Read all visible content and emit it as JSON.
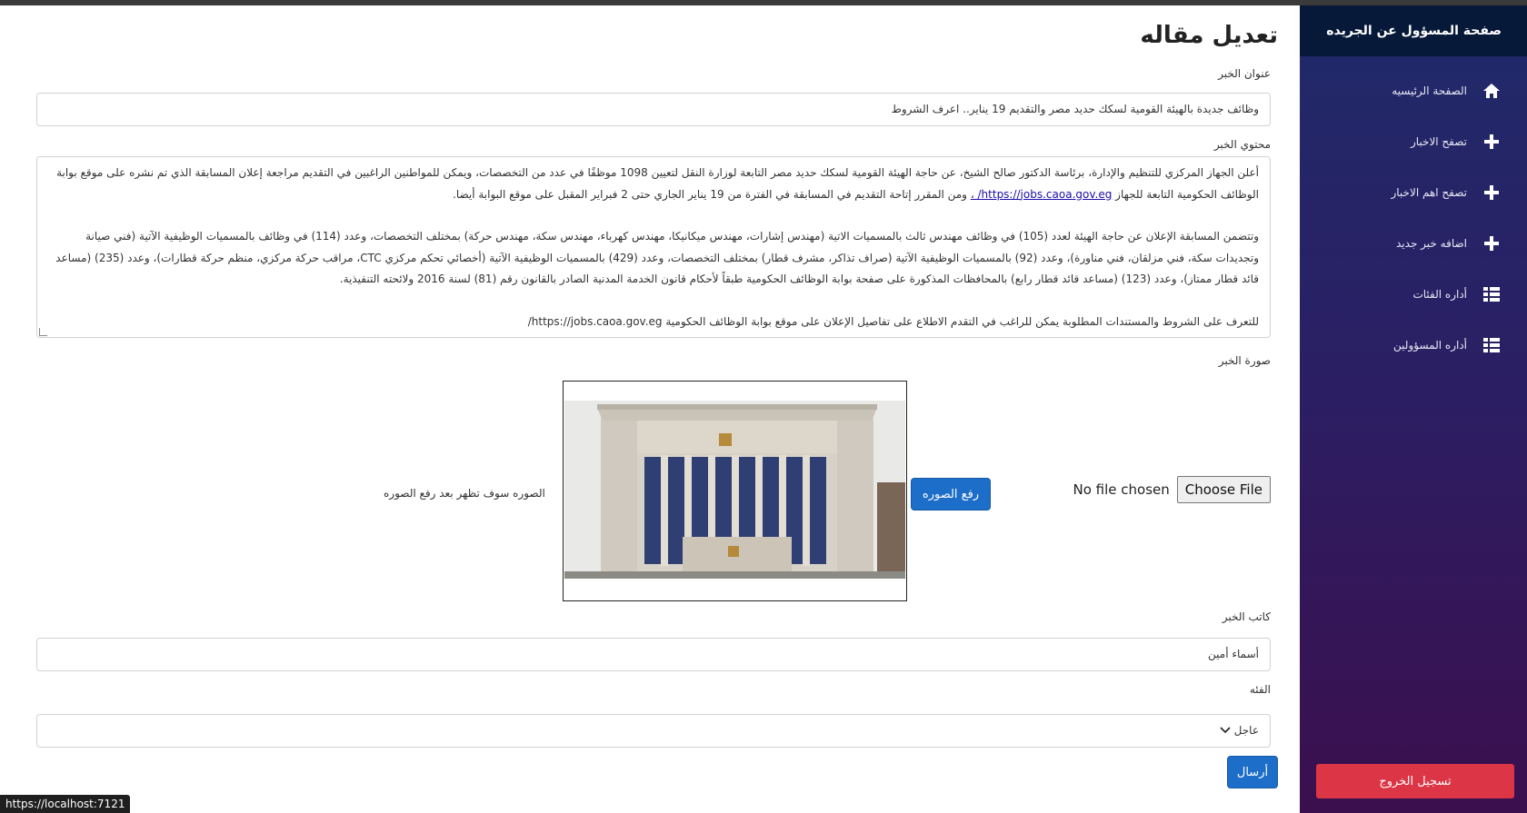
{
  "sidebar": {
    "title": "صفحة المسؤول عن الجريده",
    "items": [
      {
        "label": "الصفحة الرئيسيه",
        "icon": "home-icon"
      },
      {
        "label": "تصفح الاخبار",
        "icon": "plus-icon"
      },
      {
        "label": "تصفح اهم الاخبار",
        "icon": "plus-icon"
      },
      {
        "label": "اضافه خبر جديد",
        "icon": "plus-icon"
      },
      {
        "label": "أداره الفئات",
        "icon": "list-icon"
      },
      {
        "label": "أداره المسؤولين",
        "icon": "list-icon"
      }
    ],
    "logout_label": "تسجيل الخروج"
  },
  "form": {
    "page_title": "تعديل مقاله",
    "title_label": "عنوان الخبر",
    "title_value": "وظائف جديدة بالهيئة القومية لسكك حديد مصر والتقديم 19 يناير.. اعرف الشروط",
    "content_label": "محتوي الخبر",
    "content": {
      "p1_line1": "أعلن الجهاز المركزي للتنظيم والإدارة، برئاسة الدكتور صالح الشيخ، عن حاجة الهيئة القومية لسكك حديد مصر التابعة لوزارة النقل لتعيين 1098 موظفًا في عدد من التخصصات، ويمكن للمواطنين الراغبين في التقديم مراجعة إعلان المسابقة الذي تم نشره على",
      "p1_line2_before": "موقع بوابة الوظائف الحكومية التابعة للجهاز",
      "p1_link": "https://jobs.caoa.gov.eg/ ،",
      "p1_line2_after": "ومن المقرر إتاحة التقديم في المسابقة في الفترة من 19 يناير الجاري حتى 2 فبراير المقبل على موقع البوابة أيضا.",
      "p2": "وتتضمن المسابقة الإعلان عن حاجة الهيئة لعدد (105) في وظائف مهندس ثالث بالمسميات الاتية (مهندس إشارات، مهندس ميكانيكا، مهندس كهرباء، مهندس سكة، مهندس حركة) بمختلف التخصصات، وعدد (114) في وظائف بالمسميات الوظيفية الآتية (فني صيانة وتجديدات سكة، فني مزلقان، فني مناورة)، وعدد (92) بالمسميات الوظيفية الآتية (صراف تذاكر، مشرف قطار) بمختلف التخصصات، وعدد (429) بالمسميات الوظيفية الآتية (أخصائي تحكم مركزي CTC، مراقب حركة مركزي، منظم حركة قطارات)، وعدد (235) (مساعد قائد قطار ممتاز)، وعدد (123) (مساعد قائد قطار رابع) بالمحافظات المذكورة على صفحة بوابة الوظائف الحكومية طبقاً لأحكام قانون الخدمة المدنية الصادر بالقانون رقم (81) لسنة 2016 ولائحته التنفيذية.",
      "p3": "للتعرف على الشروط والمستندات المطلوبة يمكن للراغب في التقدم الاطلاع على تفاصيل الإعلان على موقع بوابة الوظائف الحكومية https://jobs.caoa.gov.eg/"
    },
    "image_label": "صورة الخبر",
    "choose_file_label": "Choose File",
    "file_status": "No file chosen",
    "upload_label": "رفع الصوره",
    "image_hint": "الصوره سوف تظهر بعد رفع الصوره",
    "author_label": "كاتب الخبر",
    "author_value": "أسماء أمين",
    "category_label": "الفئه",
    "category_value": "عاجل",
    "submit_label": "أرسال"
  },
  "status_url": "https://localhost:7121",
  "colors": {
    "sidebar_header": "#071938",
    "primary": "#1d6ec9",
    "danger": "#dc3545"
  }
}
